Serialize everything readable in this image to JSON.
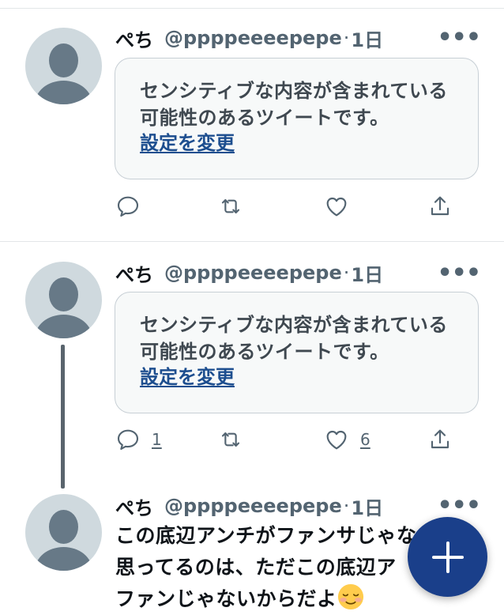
{
  "tweets": [
    {
      "author": "ぺち",
      "handle": "@ppppeeeepepe",
      "separator": "·",
      "time": "1日",
      "notice_text": "センシティブな内容が含まれている可能性のあるツイートです。",
      "notice_link": "設定を変更",
      "reply_count": "",
      "like_count": ""
    },
    {
      "author": "ぺち",
      "handle": "@ppppeeeepepe",
      "separator": "·",
      "time": "1日",
      "notice_text": "センシティブな内容が含まれている可能性のあるツイートです。",
      "notice_link": "設定を変更",
      "reply_count": "1",
      "like_count": "6"
    },
    {
      "author": "ぺち",
      "handle": "@ppppeeeepepe",
      "separator": "·",
      "time": "1日",
      "text_lines": [
        "この底辺アンチがファンサじゃな",
        "思ってるのは、ただこの底辺ア",
        "ファンじゃないからだよ"
      ],
      "emoji": "relieved-smiling-face"
    }
  ],
  "icons": {
    "more": "•••",
    "reply": "reply-icon",
    "retweet": "retweet-icon",
    "like": "heart-icon",
    "share": "share-icon",
    "compose": "plus-icon"
  },
  "colors": {
    "link": "#1d4e8f",
    "fab": "#1a3f8a",
    "muted": "#536471"
  }
}
